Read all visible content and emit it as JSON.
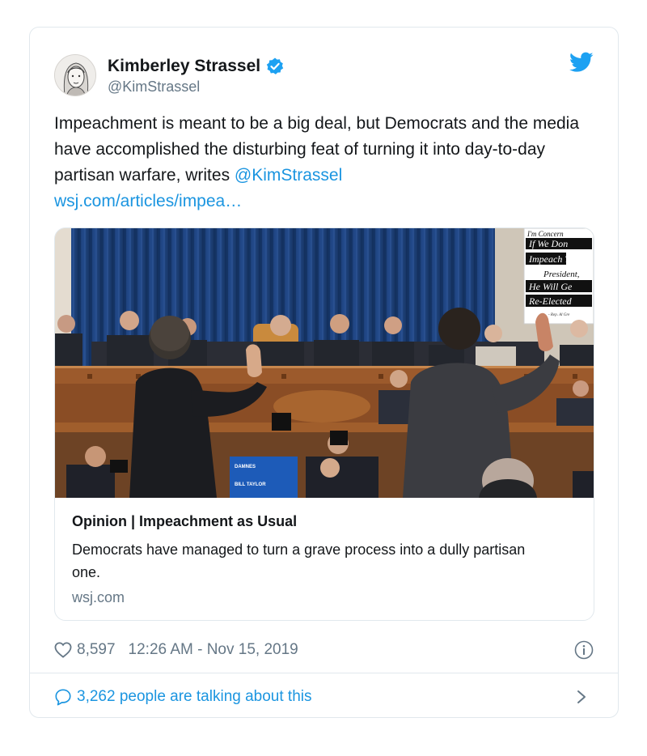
{
  "author": {
    "display_name": "Kimberley Strassel",
    "handle": "@KimStrassel",
    "verified": true,
    "avatar_icon": "author-avatar"
  },
  "platform_icon": "twitter-bird-icon",
  "tweet": {
    "text_before_mention": "Impeachment is meant to be a big deal, but Democrats and the media have accomplished the disturbing feat of turning it into day-to-day partisan warfare, writes ",
    "mention": "@KimStrassel",
    "url": "wsj.com/articles/impea…"
  },
  "card": {
    "photo_sign": {
      "lines": [
        "I'm Concern",
        "If We Don",
        "Impeach Th",
        "President,",
        "He Will Ge",
        "Re-Elected"
      ],
      "attribution": "- Rep. Al Gre"
    },
    "photo_screen": {
      "line1": "DAMNES",
      "line2": "BILL TAYLOR"
    },
    "title": "Opinion | Impeachment as Usual",
    "description": "Democrats have managed to turn a grave process into a dully partisan one.",
    "domain": "wsj.com"
  },
  "meta": {
    "likes": "8,597",
    "timestamp": "12:26 AM - Nov 15, 2019"
  },
  "footer": {
    "talking": "3,262 people are talking about this"
  },
  "colors": {
    "accent": "#1b95e0",
    "muted": "#657786",
    "border": "#e1e8ed",
    "curtain": "#1b3f79",
    "wood": "#9c5a2c"
  }
}
